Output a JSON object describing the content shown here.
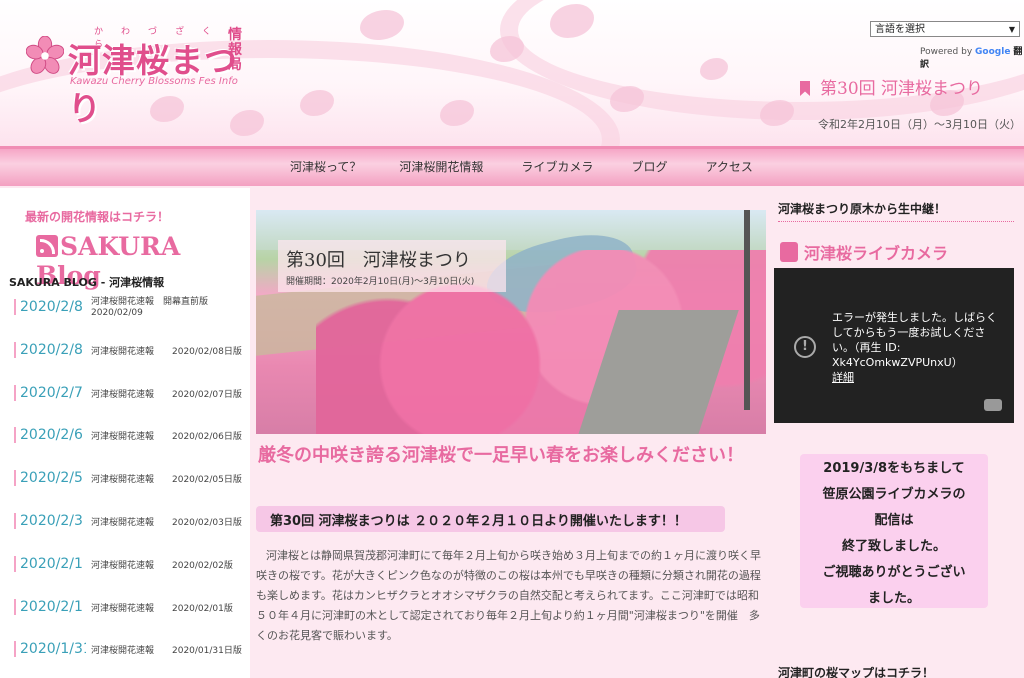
{
  "header": {
    "logo_title": "河津桜まつり",
    "logo_ruby": "かわづざくら",
    "logo_sub": "Kawazu Cherry Blossoms Fes Info",
    "logo_side": "情報局",
    "lang_select": "言語を選択",
    "powered_by": "Powered by",
    "google": "Google",
    "translate": "翻訳",
    "event_title": "第30回 河津桜まつり",
    "event_date": "令和2年2月10日（月）～3月10日（火）"
  },
  "nav": {
    "items": [
      "河津桜って？",
      "河津桜開花情報",
      "ライブカメラ",
      "ブログ",
      "アクセス"
    ]
  },
  "left": {
    "heading": "最新の開花情報はコチラ！",
    "banner": "SAKURA Blog",
    "label": "SAKURA BLOG - 河津桜情報",
    "posts": [
      {
        "date": "2020/2/8",
        "title": "河津桜開花速報　開幕直前版",
        "sub": "2020/02/09"
      },
      {
        "date": "2020/2/8",
        "title": "河津桜開花速報　　2020/02/08日版",
        "sub": ""
      },
      {
        "date": "2020/2/7",
        "title": "河津桜開花速報　　2020/02/07日版",
        "sub": ""
      },
      {
        "date": "2020/2/6",
        "title": "河津桜開花速報　　2020/02/06日版",
        "sub": ""
      },
      {
        "date": "2020/2/5",
        "title": "河津桜開花速報　　2020/02/05日版",
        "sub": ""
      },
      {
        "date": "2020/2/3",
        "title": "河津桜開花速報　　2020/02/03日版",
        "sub": ""
      },
      {
        "date": "2020/2/1",
        "title": "河津桜開花速報　　2020/02/02版",
        "sub": ""
      },
      {
        "date": "2020/2/1",
        "title": "河津桜開花速報　　2020/02/01版",
        "sub": ""
      },
      {
        "date": "2020/1/31",
        "title": "河津桜開花速報　　2020/01/31日版",
        "sub": ""
      }
    ]
  },
  "main": {
    "hero_title": "第30回　河津桜まつり",
    "hero_sub": "開催期間：2020年2月10日(月)～3月10日(火)",
    "headline": "厳冬の中咲き誇る河津桜で一足早い春をお楽しみください！",
    "announcement": "第30回 河津桜まつりは ２０２０年２月１０日より開催いたします！！",
    "body": "河津桜とは静岡県賀茂郡河津町にて毎年２月上旬から咲き始め３月上旬までの約１ヶ月に渡り咲く早咲きの桜です。花が大きくピンク色なのが特徴のこの桜は本州でも早咲きの種類に分類され開花の過程も楽しめます。花はカンヒザクラとオオシマザクラの自然交配と考えられてます。ここ河津町では昭和５０年４月に河津町の木として認定されており毎年２月上旬より約１ヶ月間\"河津桜まつり\"を開催　多くのお花見客で賑わいます。"
  },
  "right": {
    "heading": "河津桜まつり原木から生中継！",
    "yt_title": "河津桜ライブカメラ",
    "video_error": "エラーが発生しました。しばらくしてからもう一度お試しください。（再生 ID: Xk4YcOmkwZVPUnxU）",
    "video_link": "詳細",
    "notice": [
      "2019/3/8をもちまして",
      "笹原公園ライブカメラの",
      "配信は",
      "終了致しました。",
      "ご視聴ありがとうござい",
      "ました。"
    ],
    "footer": "河津町の桜マップはコチラ！"
  },
  "colors": {
    "accent": "#e86aa0",
    "nav": "#f6a6c6",
    "notice_bg": "#fbd0ee"
  }
}
